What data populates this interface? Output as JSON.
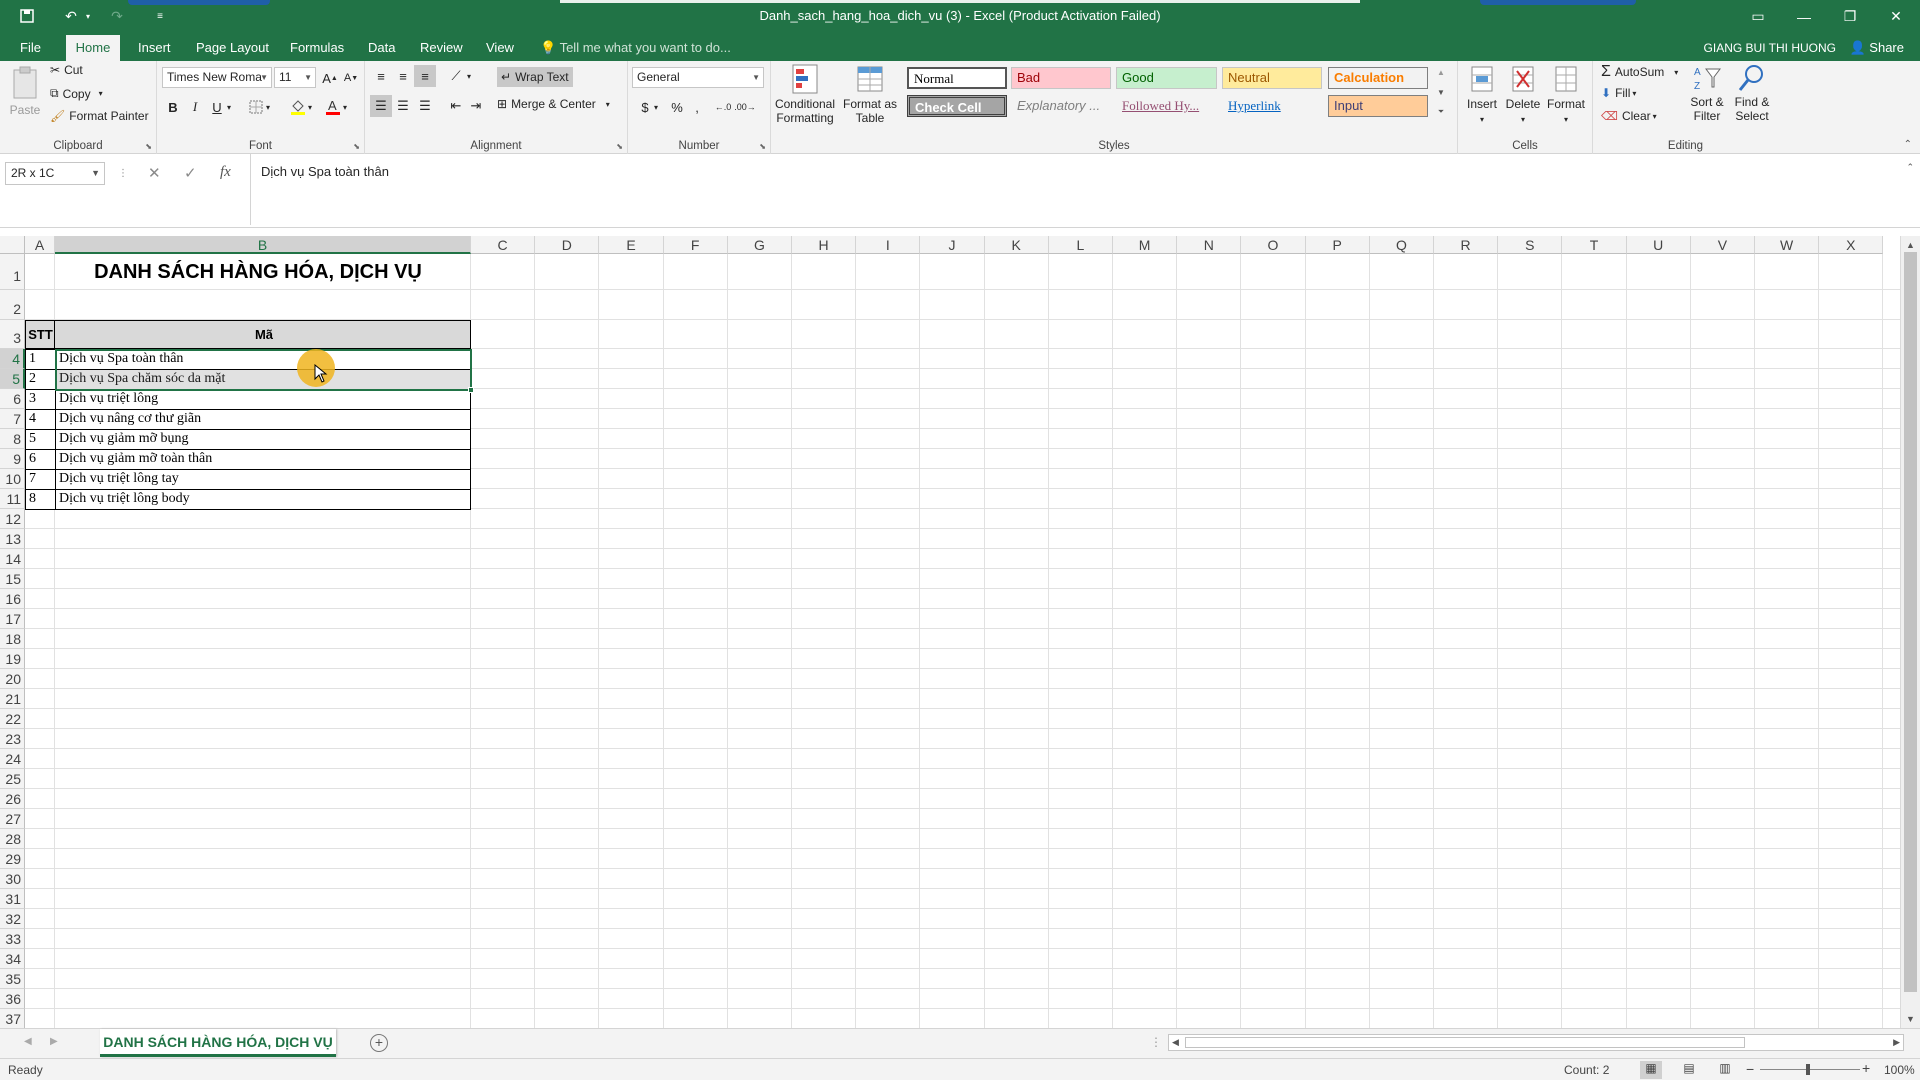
{
  "app": {
    "title": "Danh_sach_hang_hoa_dich_vu (3) - Excel (Product Activation Failed)",
    "user": "GIANG BUI THI HUONG",
    "share_label": "Share"
  },
  "ribbon_tabs": [
    "File",
    "Home",
    "Insert",
    "Page Layout",
    "Formulas",
    "Data",
    "Review",
    "View"
  ],
  "active_tab": "Home",
  "tell_me_placeholder": "Tell me what you want to do...",
  "clipboard": {
    "paste": "Paste",
    "cut": "Cut",
    "copy": "Copy",
    "format_painter": "Format Painter",
    "label": "Clipboard"
  },
  "font": {
    "name": "Times New Roma",
    "size": "11",
    "label": "Font",
    "bold": "B",
    "italic": "I",
    "underline": "U"
  },
  "alignment": {
    "wrap_text": "Wrap Text",
    "merge_center": "Merge & Center",
    "label": "Alignment"
  },
  "number": {
    "format": "General",
    "label": "Number",
    "currency": "$",
    "percent": "%",
    "comma": ","
  },
  "styles": {
    "conditional_formatting": "Conditional Formatting",
    "format_as_table": "Format as Table",
    "normal": "Normal",
    "bad": "Bad",
    "good": "Good",
    "neutral": "Neutral",
    "calculation": "Calculation",
    "check_cell": "Check Cell",
    "explanatory": "Explanatory ...",
    "followed_hyperlink": "Followed Hy...",
    "hyperlink": "Hyperlink",
    "input": "Input",
    "label": "Styles"
  },
  "cells_group": {
    "insert": "Insert",
    "delete": "Delete",
    "format": "Format",
    "label": "Cells"
  },
  "editing": {
    "autosum": "AutoSum",
    "fill": "Fill",
    "clear": "Clear",
    "sort_filter": "Sort & Filter",
    "find_select": "Find & Select",
    "label": "Editing"
  },
  "formula_bar": {
    "name_box": "2R x 1C",
    "formula": "Dịch vụ Spa toàn thân",
    "fx": "fx"
  },
  "columns": [
    "A",
    "B",
    "C",
    "D",
    "E",
    "F",
    "G",
    "H",
    "I",
    "J",
    "K",
    "L",
    "M",
    "N",
    "O",
    "P",
    "Q",
    "R",
    "S",
    "T",
    "U",
    "V",
    "W",
    "X"
  ],
  "sheet": {
    "title": "DANH SÁCH HÀNG HÓA, DỊCH VỤ",
    "header_stt": "STT",
    "header_ma": "Mã",
    "rows": [
      {
        "stt": "1",
        "name": "Dịch vụ Spa toàn thân"
      },
      {
        "stt": "2",
        "name": "Dịch vụ Spa chăm sóc da mặt"
      },
      {
        "stt": "3",
        "name": "Dịch vụ triệt lông"
      },
      {
        "stt": "4",
        "name": "Dịch vụ nâng cơ thư giãn"
      },
      {
        "stt": "5",
        "name": "Dịch vụ giảm mỡ bụng"
      },
      {
        "stt": "6",
        "name": "Dịch vụ giảm mỡ toàn thân"
      },
      {
        "stt": "7",
        "name": "Dịch vụ triệt lông tay"
      },
      {
        "stt": "8",
        "name": "Dịch vụ triệt lông body"
      }
    ]
  },
  "sheet_tab": "DANH SÁCH HÀNG HÓA, DỊCH VỤ",
  "status": {
    "ready": "Ready",
    "count": "Count: 2",
    "zoom": "100%"
  },
  "colors": {
    "excel_green": "#217346",
    "bad_bg": "#ffc7ce",
    "good_bg": "#c6efce",
    "neutral_bg": "#ffeb9c",
    "input_bg": "#ffcc99",
    "check_cell_bg": "#a5a5a5"
  }
}
